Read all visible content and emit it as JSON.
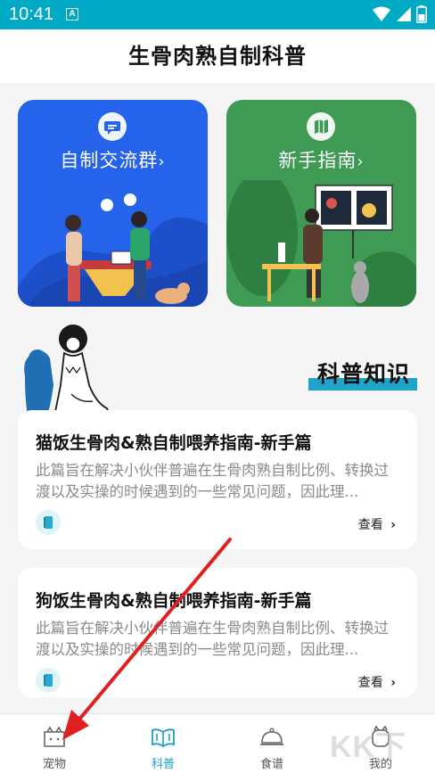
{
  "status_bar": {
    "time": "10:41",
    "indicator": "A",
    "icons": [
      "wifi-icon",
      "signal-icon",
      "battery-icon"
    ]
  },
  "header": {
    "title": "生骨肉熟自制科普"
  },
  "cards": [
    {
      "label": "自制交流群",
      "chevron": "›",
      "icon": "chat-bubble-icon",
      "color": "#2563eb"
    },
    {
      "label": "新手指南",
      "chevron": "›",
      "icon": "map-icon",
      "color": "#3f9a54"
    }
  ],
  "section": {
    "title": "科普知识",
    "accent": "#1fa3c8"
  },
  "articles": [
    {
      "title": "猫饭生骨肉&熟自制喂养指南-新手篇",
      "desc": "此篇旨在解决小伙伴普遍在生骨肉熟自制比例、转换过渡以及实操的时候遇到的一些常见问题，因此理...",
      "read_label": "查看",
      "icon": "book-icon"
    },
    {
      "title": "狗饭生骨肉&熟自制喂养指南-新手篇",
      "desc": "此篇旨在解决小伙伴普遍在生骨肉熟自制比例、转换过渡以及实操的时候遇到的一些常见问题，因此理...",
      "read_label": "查看",
      "icon": "book-icon"
    }
  ],
  "bottom_nav": [
    {
      "label": "宠物",
      "icon": "pet-icon",
      "active": false
    },
    {
      "label": "科普",
      "icon": "book-open-icon",
      "active": true
    },
    {
      "label": "食谱",
      "icon": "food-cloche-icon",
      "active": false
    },
    {
      "label": "我的",
      "icon": "profile-icon",
      "active": false
    }
  ],
  "colors": {
    "status_bar": "#00aac4",
    "accent": "#1f9fc4",
    "annotation_arrow": "#e02020"
  },
  "watermark": "KK下载"
}
